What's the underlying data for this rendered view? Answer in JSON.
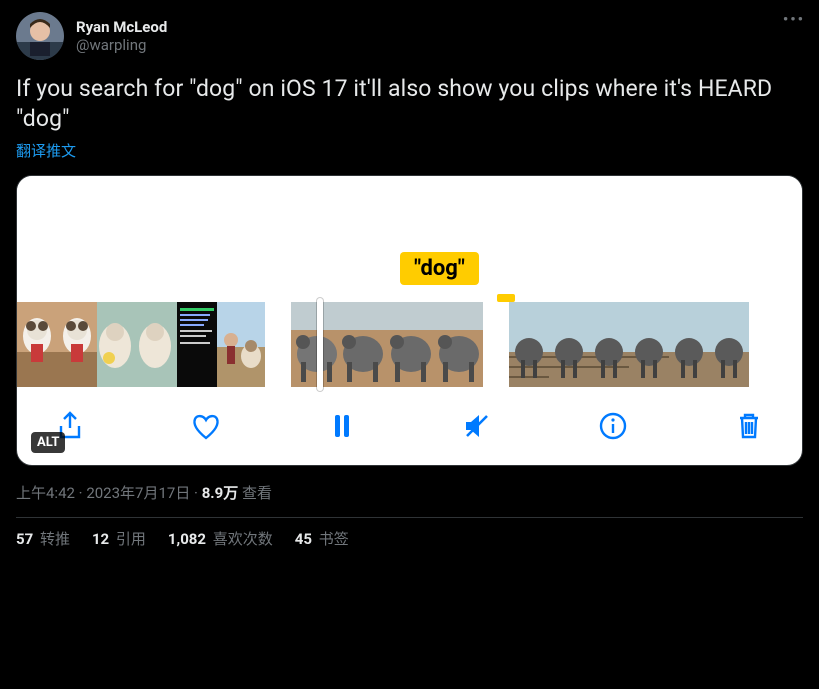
{
  "author": {
    "display_name": "Ryan McLeod",
    "handle": "@warpling"
  },
  "text": "If you search for \"dog\" on iOS 17 it'll also show you clips where it's HEARD \"dog\"",
  "translate_label": "翻译推文",
  "bubble_text": "\"dog\"",
  "alt_badge": "ALT",
  "meta": {
    "time": "上午4:42",
    "date": "2023年7月17日",
    "views_count": "8.9万",
    "views_label": " 查看",
    "dot": " · "
  },
  "stats": {
    "retweets_count": "57",
    "retweets_label": " 转推",
    "quotes_count": "12",
    "quotes_label": " 引用",
    "likes_count": "1,082",
    "likes_label": " 喜欢次数",
    "bookmarks_count": "45",
    "bookmarks_label": " 书签"
  },
  "icons": {
    "share": "share-icon",
    "heart": "heart-icon",
    "pause": "pause-icon",
    "mute": "mute-icon",
    "info": "info-icon",
    "trash": "trash-icon",
    "more": "more-icon"
  }
}
